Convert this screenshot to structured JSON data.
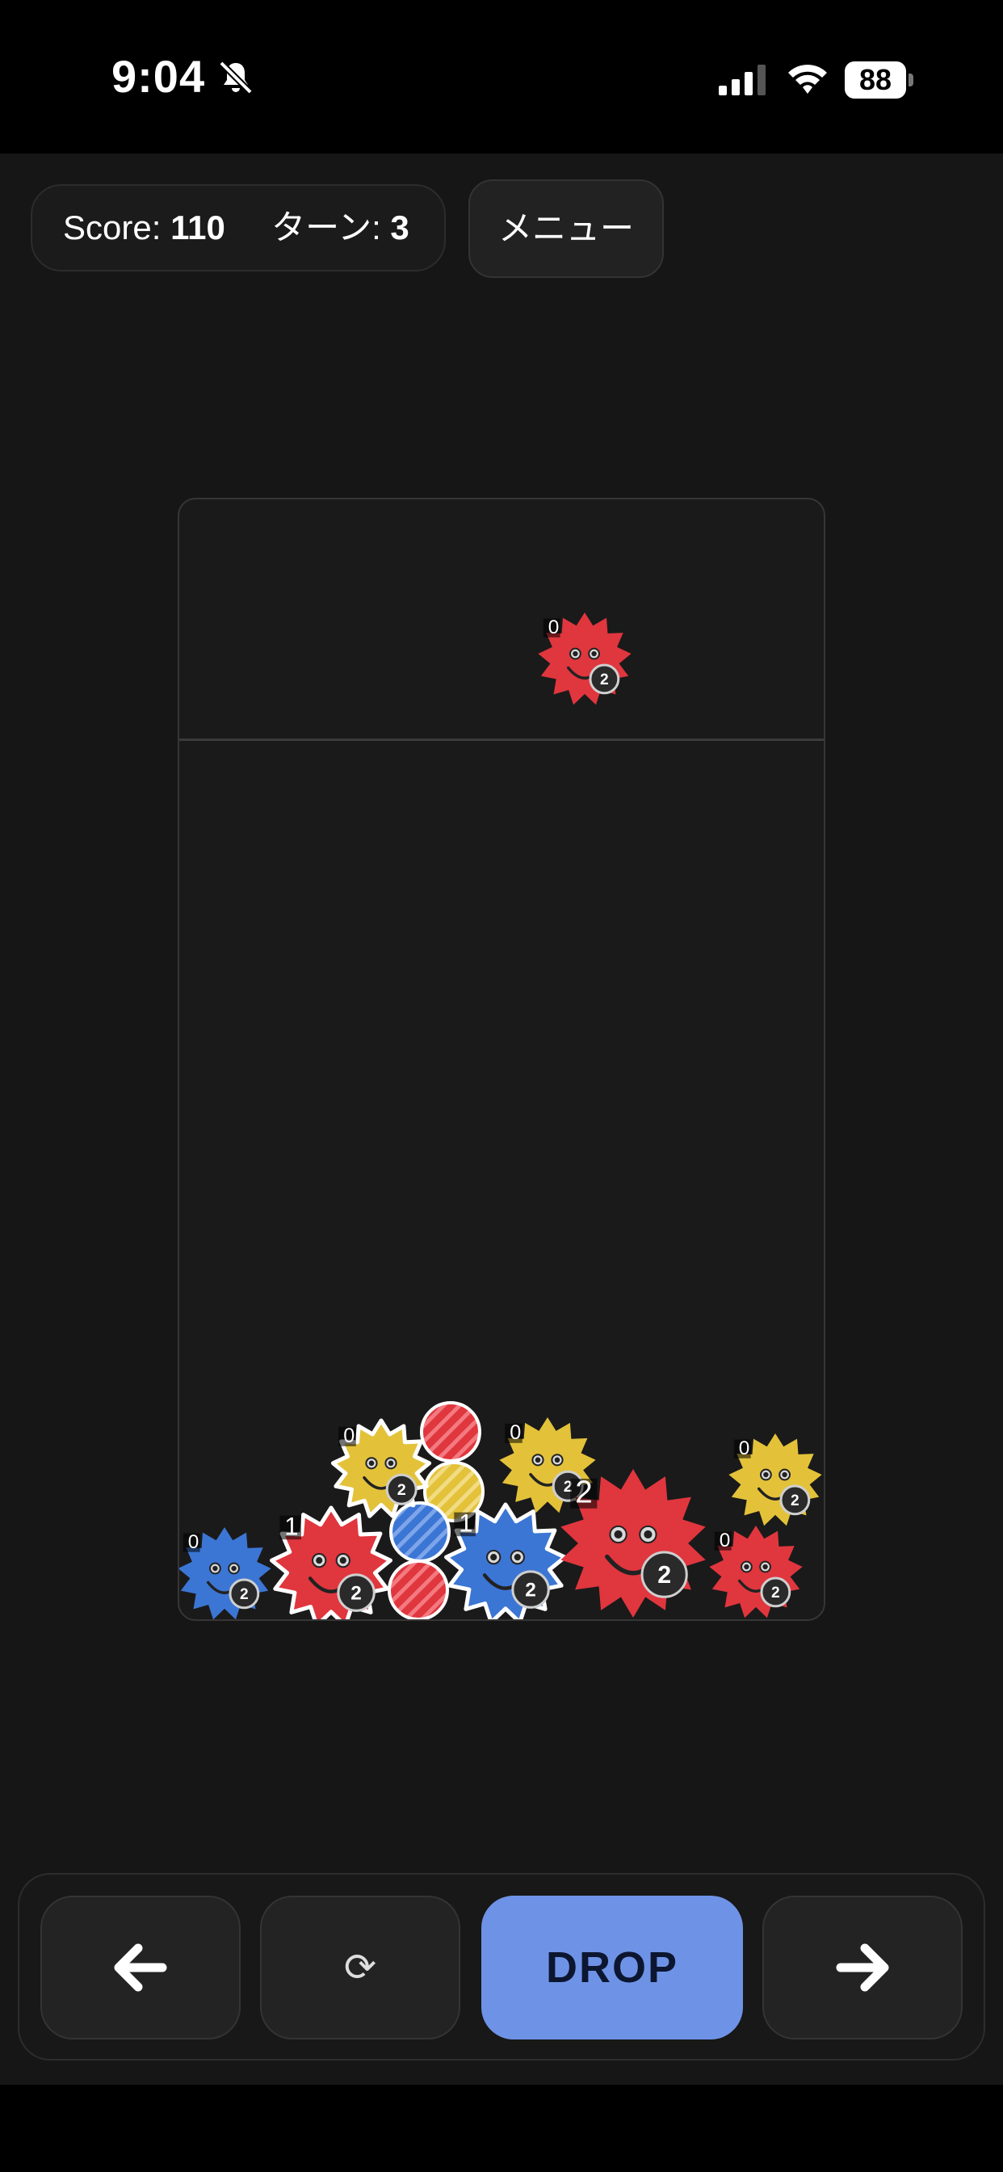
{
  "status_bar": {
    "time": "9:04",
    "battery": "88"
  },
  "hud": {
    "score_label": "Score:",
    "score_value": "110",
    "turn_label": "ターン:",
    "turn_value": "3"
  },
  "menu_label": "メニュー",
  "controls": {
    "left_icon": "arrow-left-icon",
    "rotate_label": "⟳",
    "drop_label": "DROP",
    "right_icon": "arrow-right-icon"
  },
  "colors": {
    "red": "#e0363e",
    "blue": "#3c76d4",
    "yellow": "#e3c23a",
    "drop_button": "#6e93e6"
  },
  "pieces": {
    "next": {
      "color": "red",
      "tag": "0",
      "badge": "2"
    },
    "blue_left": {
      "color": "blue",
      "tag": "0",
      "badge": "2"
    },
    "red_mid": {
      "color": "red",
      "tag": "1",
      "badge": "2"
    },
    "yellow_top": {
      "color": "yellow",
      "tag": "0",
      "badge": "2"
    },
    "blue_mid": {
      "color": "blue",
      "tag": "1",
      "badge": "2"
    },
    "yellow_mid": {
      "color": "yellow",
      "tag": "0",
      "badge": "2"
    },
    "red_big": {
      "color": "red",
      "tag": "2",
      "badge": "2"
    },
    "red_right": {
      "color": "red",
      "tag": "0",
      "badge": "2"
    },
    "yellow_right": {
      "color": "yellow",
      "tag": "0",
      "badge": "2"
    }
  }
}
